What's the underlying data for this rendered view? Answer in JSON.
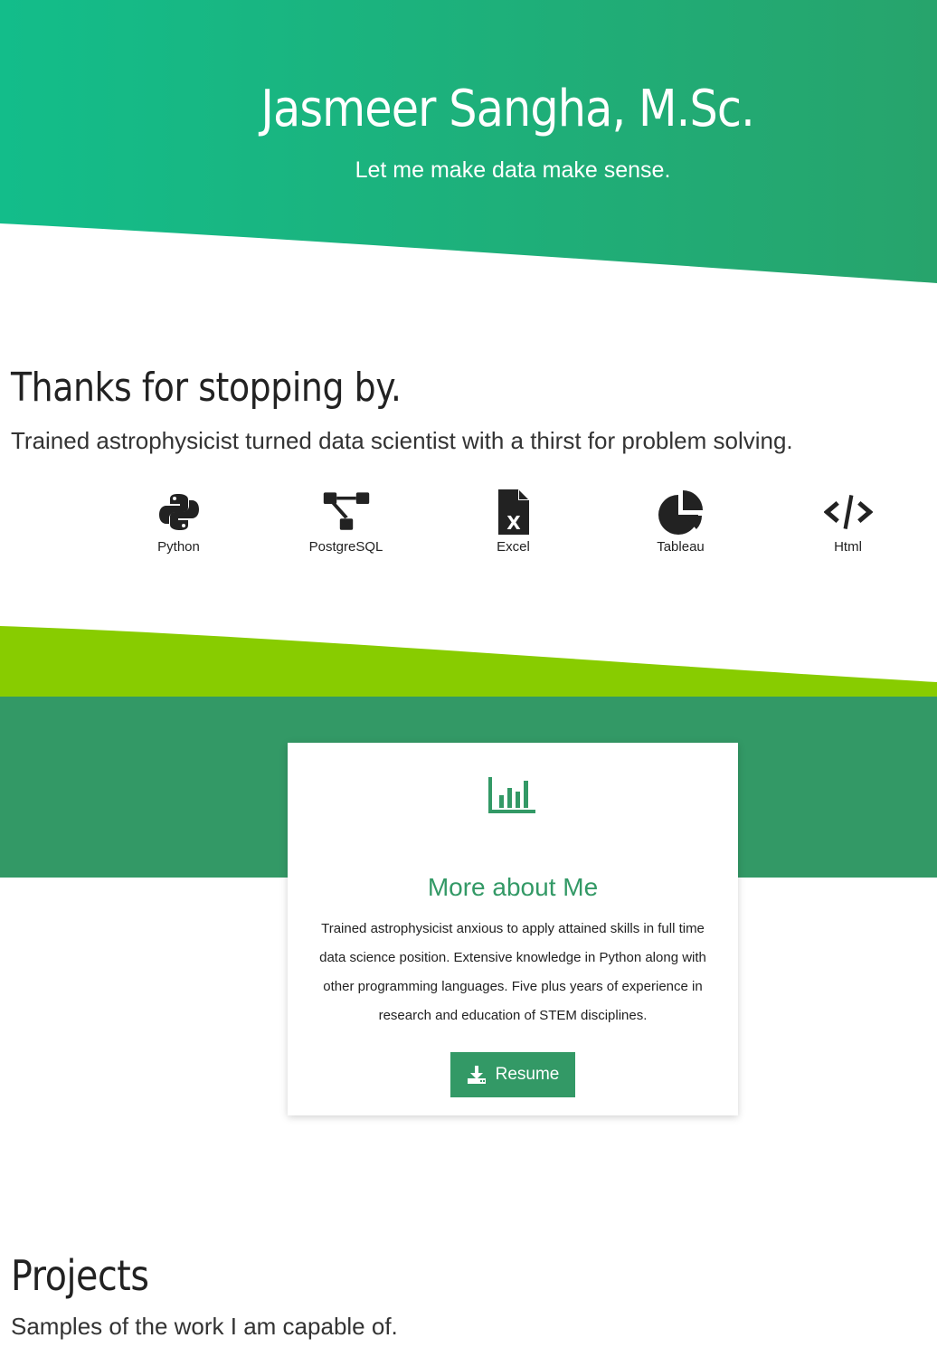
{
  "hero": {
    "title": "Jasmeer Sangha, M.Sc.",
    "tagline": "Let me make data make sense.",
    "colors": {
      "gradient_start": "#13bd8a",
      "gradient_end": "#27a46c"
    }
  },
  "intro": {
    "heading": "Thanks for stopping by.",
    "subheading": "Trained astrophysicist turned data scientist with a thirst for problem solving."
  },
  "skills": [
    {
      "label": "Python",
      "icon": "python-icon"
    },
    {
      "label": "PostgreSQL",
      "icon": "sitemap-icon"
    },
    {
      "label": "Excel",
      "icon": "excel-file-icon"
    },
    {
      "label": "Tableau",
      "icon": "pie-chart-icon"
    },
    {
      "label": "Html",
      "icon": "code-icon"
    }
  ],
  "about": {
    "icon": "bar-chart-icon",
    "title": "More about Me",
    "body": "Trained astrophysicist anxious to apply attained skills in full time data science position. Extensive knowledge in Python along with other programming languages. Five plus years of experience in research and education of STEM disciplines.",
    "button_label": "Resume",
    "button_icon": "download-icon",
    "colors": {
      "accent": "#339966",
      "band_light": "#88cc00",
      "band_dark": "#339966"
    }
  },
  "projects": {
    "heading": "Projects",
    "subheading": "Samples of the work I am capable of."
  }
}
